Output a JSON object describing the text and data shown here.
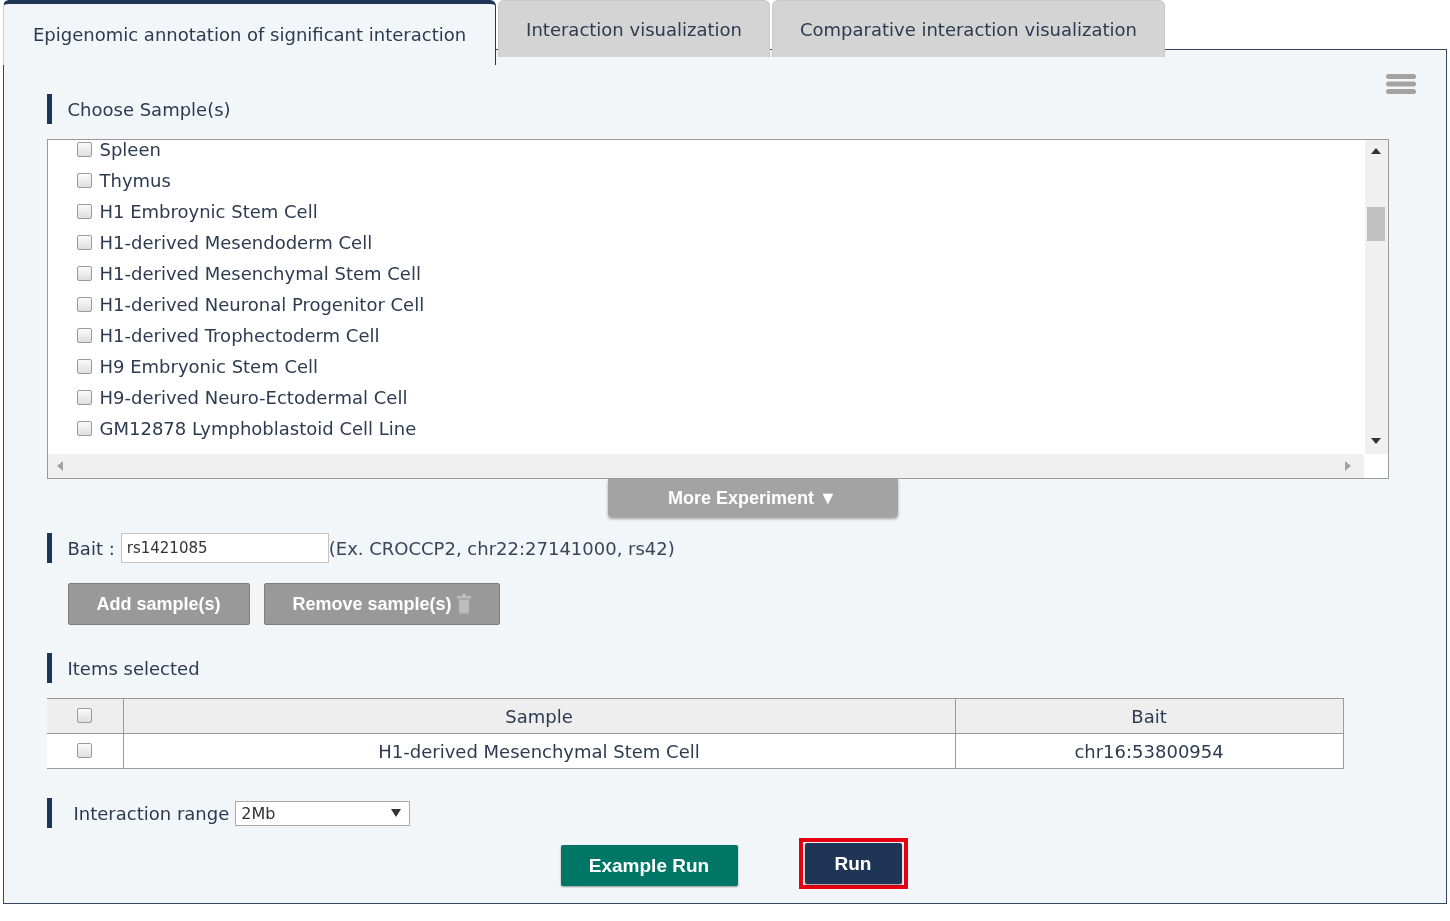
{
  "tabs": [
    {
      "label": "Epigenomic annotation of significant interaction",
      "selected": true
    },
    {
      "label": "Interaction visualization",
      "selected": false
    },
    {
      "label": "Comparative interaction visualization",
      "selected": false
    }
  ],
  "choose_samples": {
    "heading": "Choose Sample(s)",
    "samples": [
      {
        "label": "Spleen",
        "checked": false
      },
      {
        "label": "Thymus",
        "checked": false
      },
      {
        "label": "H1 Embroynic Stem Cell",
        "checked": false
      },
      {
        "label": "H1-derived Mesendoderm Cell",
        "checked": false
      },
      {
        "label": "H1-derived Mesenchymal Stem Cell",
        "checked": false
      },
      {
        "label": "H1-derived Neuronal Progenitor Cell",
        "checked": false
      },
      {
        "label": "H1-derived Trophectoderm Cell",
        "checked": false
      },
      {
        "label": "H9 Embryonic Stem Cell",
        "checked": false
      },
      {
        "label": "H9-derived Neuro-Ectodermal Cell",
        "checked": false
      },
      {
        "label": "GM12878 Lymphoblastoid Cell Line",
        "checked": false
      }
    ]
  },
  "more_button": "More Experiment ▼",
  "bait": {
    "label": "Bait :",
    "value": "rs1421085",
    "hint": "(Ex. CROCCP2, chr22:27141000, rs42)"
  },
  "sample_buttons": [
    {
      "label": "Add sample(s)",
      "kind": "add"
    },
    {
      "label": "Remove sample(s)",
      "kind": "remove"
    }
  ],
  "items_selected": {
    "heading": "Items selected",
    "header_checked": false,
    "columns": [
      "Sample",
      "Bait"
    ],
    "rows": [
      {
        "checked": false,
        "sample": "H1-derived Mesenchymal Stem Cell",
        "bait": "chr16:53800954"
      }
    ]
  },
  "interaction_range": {
    "label": "Interaction range",
    "value": "2Mb"
  },
  "actions": [
    {
      "label": "Example Run",
      "kind": "example",
      "highlighted": false
    },
    {
      "label": "Run",
      "kind": "run",
      "highlighted": true
    }
  ]
}
